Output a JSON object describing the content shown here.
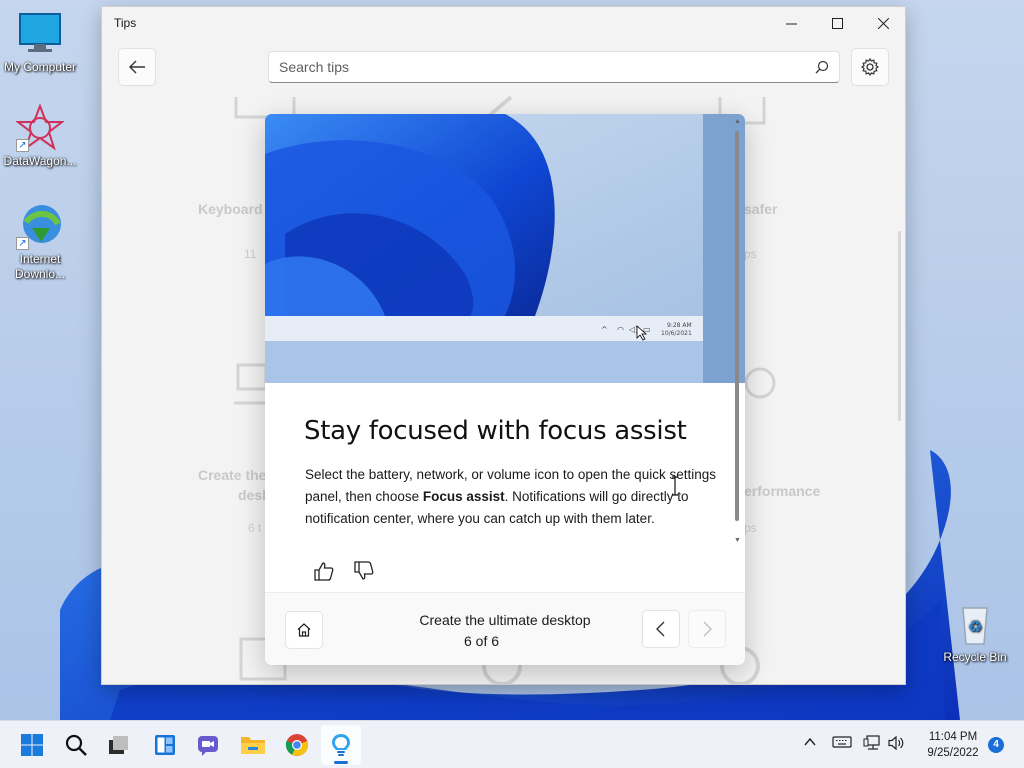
{
  "desktop": {
    "icons": [
      {
        "label": "My Computer",
        "icon": "monitor-icon"
      },
      {
        "label": "DataWagon...",
        "icon": "datawagon-icon"
      },
      {
        "label": "Internet Downlo...",
        "icon": "internet-download-manager-icon"
      },
      {
        "label": "Recycle Bin",
        "icon": "recycle-bin-icon"
      }
    ]
  },
  "window": {
    "title": "Tips",
    "search": {
      "placeholder": "Search tips",
      "value": ""
    },
    "background_cards": [
      {
        "label": "Keyboard",
        "sub": "11"
      },
      {
        "label": "safer",
        "sub": "ps"
      },
      {
        "label": "Create the",
        "sub": "desk"
      },
      {
        "label": "6 t",
        "sub": ""
      },
      {
        "label": "erformance",
        "sub": "ps"
      }
    ]
  },
  "dialog": {
    "title": "Stay focused with focus assist",
    "body_before": "Select the battery, network, or volume icon to open the quick settings panel, then choose ",
    "body_bold": "Focus assist",
    "body_after": ". Notifications will go directly to notification center, where you can catch up with them later.",
    "image_clock_time": "9:28 AM",
    "image_clock_date": "10/6/2021",
    "footer": {
      "title": "Create the ultimate desktop",
      "page": "6 of 6"
    }
  },
  "taskbar": {
    "apps": [
      "start-icon",
      "search-icon",
      "task-view-icon",
      "widgets-icon",
      "chat-icon",
      "file-explorer-icon",
      "chrome-icon",
      "tips-icon"
    ],
    "clock_time": "11:04 PM",
    "clock_date": "9/25/2022",
    "notification_count": "4"
  },
  "colors": {
    "accent": "#1a6fd6",
    "wallpaper_blue": "#1a4fd6"
  }
}
